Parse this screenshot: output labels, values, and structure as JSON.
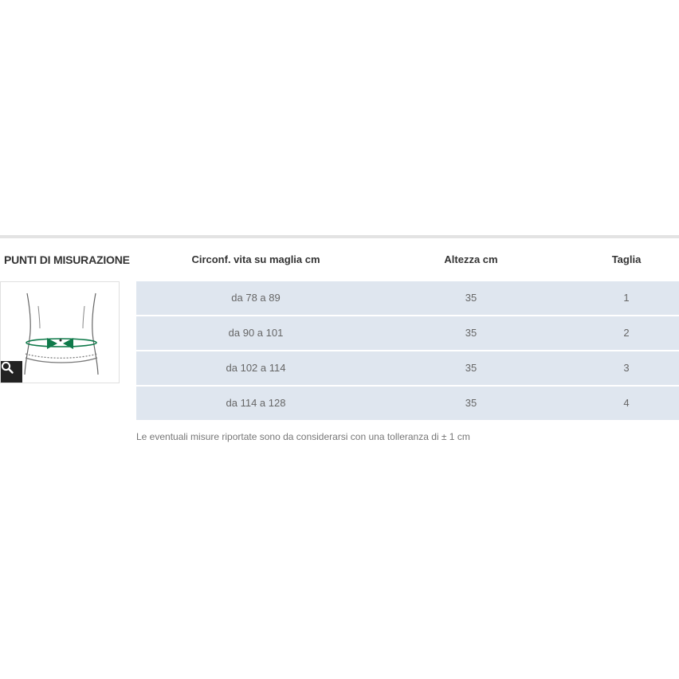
{
  "left": {
    "title": "PUNTI DI MISURAZIONE"
  },
  "table": {
    "headers": [
      "Circonf. vita su maglia cm",
      "Altezza cm",
      "Taglia"
    ],
    "rows": [
      [
        "da 78 a 89",
        "35",
        "1"
      ],
      [
        "da 90 a 101",
        "35",
        "2"
      ],
      [
        "da 102 a 114",
        "35",
        "3"
      ],
      [
        "da 114 a 128",
        "35",
        "4"
      ]
    ]
  },
  "note": "Le eventuali misure riportate sono da considerarsi con una tolleranza di ± 1 cm",
  "colors": {
    "row_bg": "#dfe6ef",
    "accent_green": "#0f7a4a",
    "zoom_bg": "#222222"
  },
  "icons": {
    "zoom": "search-icon",
    "diagram": "waist-measurement-diagram"
  }
}
